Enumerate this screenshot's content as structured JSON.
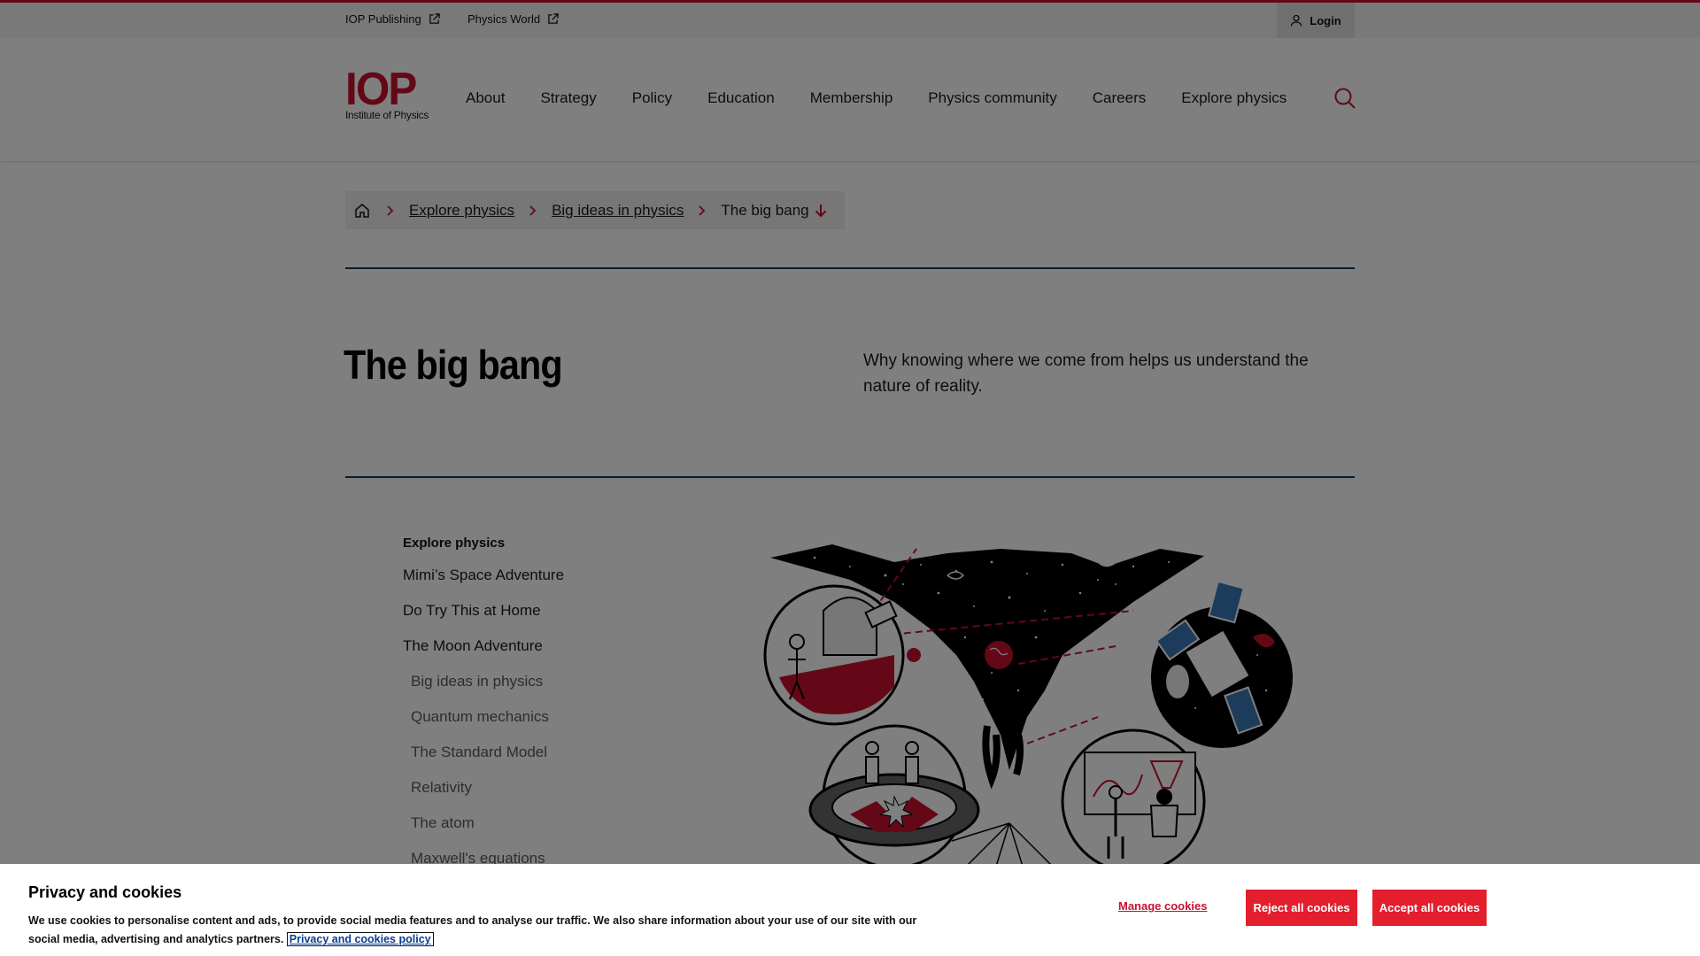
{
  "utility": {
    "links": [
      {
        "label": "IOP Publishing"
      },
      {
        "label": "Physics World"
      }
    ],
    "login_label": "Login"
  },
  "header": {
    "logo_main": "IOP",
    "logo_sub": "Institute of Physics",
    "nav": [
      "About",
      "Strategy",
      "Policy",
      "Education",
      "Membership",
      "Physics community",
      "Careers",
      "Explore physics"
    ]
  },
  "breadcrumb": {
    "items": [
      "Explore physics",
      "Big ideas in physics"
    ],
    "current": "The big bang"
  },
  "page": {
    "title": "The big bang",
    "intro": "Why knowing where we come from helps us understand the nature of reality."
  },
  "sidenav": {
    "heading": "Explore physics",
    "items": [
      "Mimi’s Space Adventure",
      "Do Try This at Home",
      "The Moon Adventure"
    ],
    "sub_items": [
      "Big ideas in physics",
      "Quantum mechanics",
      "The Standard Model",
      "Relativity",
      "The atom",
      "Maxwell's equations"
    ]
  },
  "cookie": {
    "title": "Privacy and cookies",
    "text": "We use cookies to personalise content and ads, to provide social media features and to analyse our traffic. We also share information about your use of our site with our social media, advertising and analytics partners.",
    "policy_link": "Privacy and cookies policy",
    "manage_label": "Manage cookies",
    "reject_label": "Reject all cookies",
    "accept_label": "Accept all cookies"
  },
  "colors": {
    "brand_red": "#c8102e",
    "rule_blue": "#003a70",
    "button_red": "#e31e2d"
  }
}
